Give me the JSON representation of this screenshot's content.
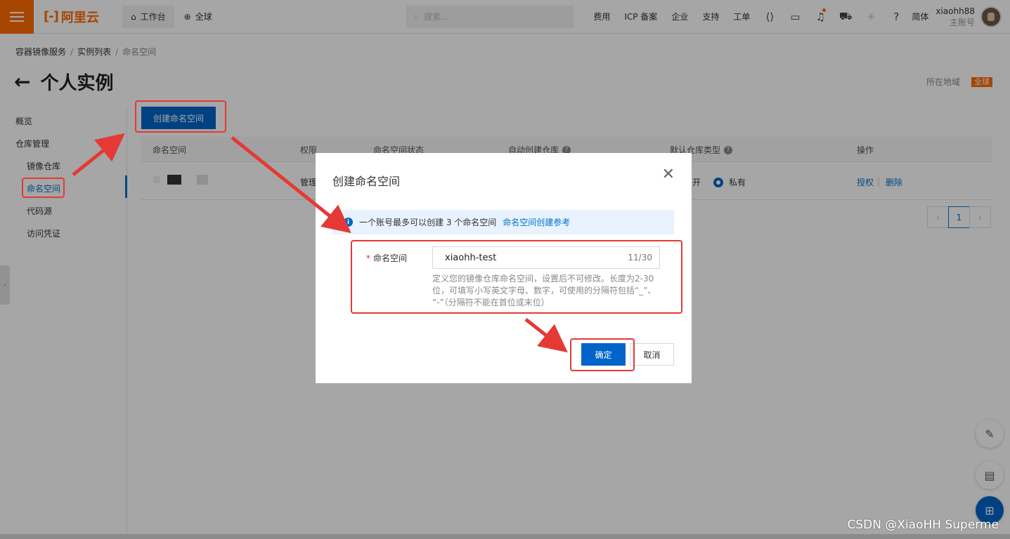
{
  "topbar": {
    "logo_text": "阿里云",
    "workbench": "工作台",
    "global": "全球",
    "search_placeholder": "搜索...",
    "links": [
      "费用",
      "ICP 备案",
      "企业",
      "支持",
      "工单"
    ],
    "lang": "简体",
    "username": "xiaohh88",
    "role": "主账号"
  },
  "breadcrumb": [
    "容器镜像服务",
    "实例列表",
    "命名空间"
  ],
  "page": {
    "title": "个人实例",
    "region_label": "所在地域",
    "region_badge": "全球"
  },
  "sidebar": {
    "overview": "概览",
    "repo_mgmt": "仓库管理",
    "items": [
      "镜像仓库",
      "命名空间",
      "代码源",
      "访问凭证"
    ]
  },
  "main": {
    "create_button": "创建命名空间",
    "columns": [
      "命名空间",
      "权限",
      "命名空间状态",
      "自动创建仓库",
      "默认仓库类型",
      "操作"
    ],
    "row": {
      "permission": "管理",
      "auto_create_suffix": "开",
      "repo_type": "私有",
      "action_auth": "授权",
      "action_delete": "删除"
    },
    "pagination": {
      "current": "1",
      "prev": "‹",
      "next": "›"
    }
  },
  "dialog": {
    "title": "创建命名空间",
    "notice": "一个账号最多可以创建 3 个命名空间",
    "notice_link": "命名空间创建参考",
    "field_label": "命名空间",
    "field_value": "xiaohh-test",
    "field_count": "11/30",
    "help_lines": [
      "定义您的镜像仓库命名空间，设置后不可修改。长度为2-30",
      "位，可填写小写英文字母、数字，可使用的分隔符包括“_”、",
      "“-”（分隔符不能在首位或末位）"
    ],
    "ok": "确定",
    "cancel": "取消"
  },
  "watermark": "CSDN @XiaoHH Superme",
  "colors": {
    "brand": "#ff6a00",
    "primary": "#0064c8",
    "annotation": "#e53935"
  }
}
